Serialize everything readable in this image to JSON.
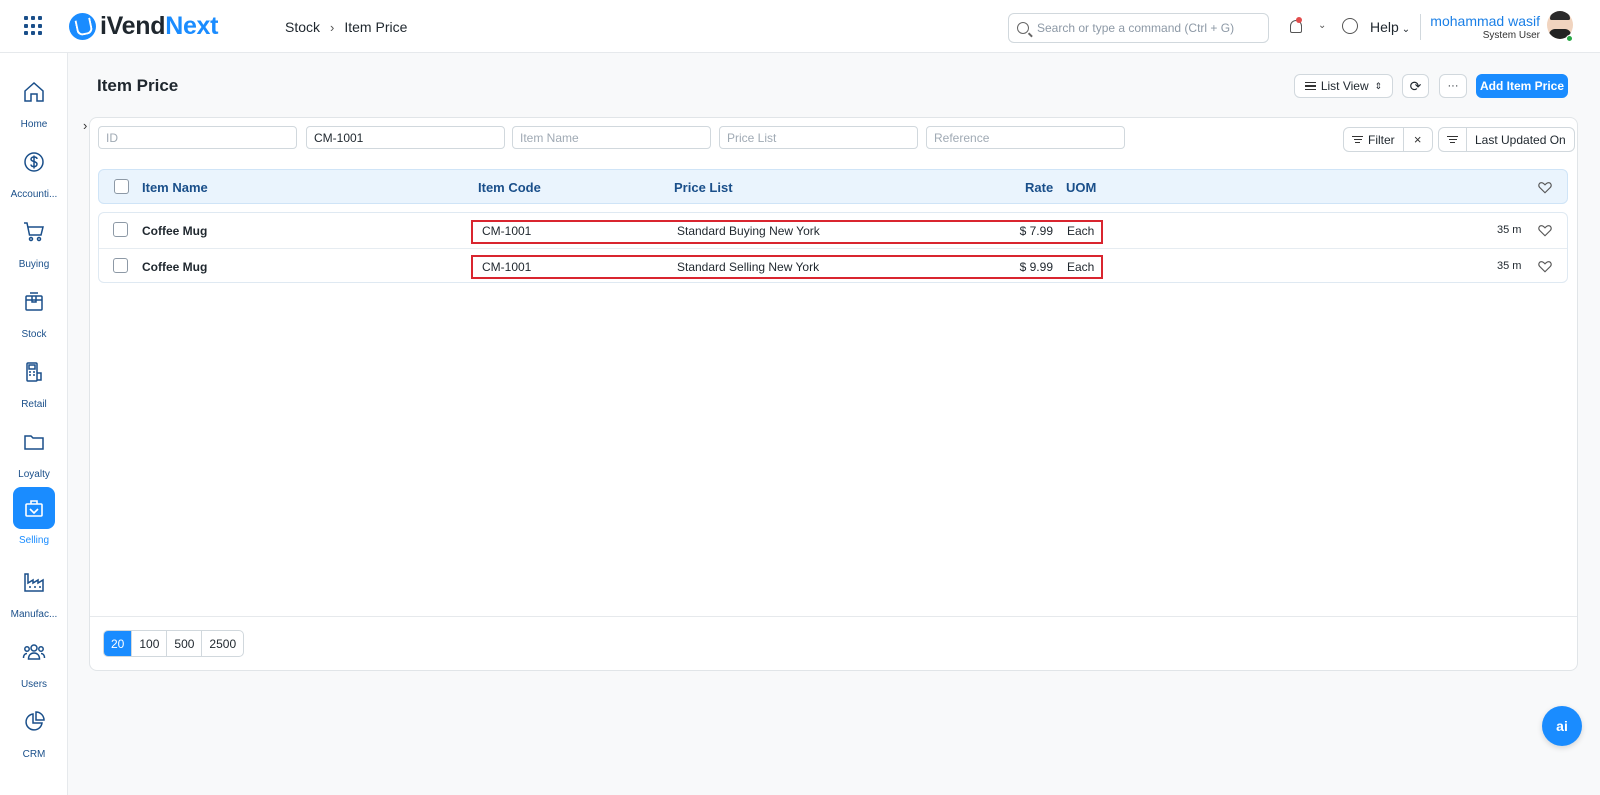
{
  "app": {
    "name_part1": "iVend",
    "name_part2": "Next"
  },
  "breadcrumb": {
    "parent": "Stock",
    "separator": "›",
    "current": "Item Price"
  },
  "search": {
    "placeholder": "Search or type a command (Ctrl + G)"
  },
  "header": {
    "help_label": "Help",
    "chevron": "⌄"
  },
  "user": {
    "name": "mohammad wasif",
    "role": "System User"
  },
  "sidebar": {
    "items": [
      {
        "label": "Home",
        "icon": "home-icon"
      },
      {
        "label": "Accounti...",
        "icon": "dollar-icon"
      },
      {
        "label": "Buying",
        "icon": "cart-icon"
      },
      {
        "label": "Stock",
        "icon": "box-icon"
      },
      {
        "label": "Retail",
        "icon": "pos-icon"
      },
      {
        "label": "Loyalty",
        "icon": "folder-icon"
      },
      {
        "label": "Selling",
        "icon": "bag-icon",
        "active": true
      },
      {
        "label": "Manufac...",
        "icon": "factory-icon"
      },
      {
        "label": "Users",
        "icon": "users-icon"
      },
      {
        "label": "CRM",
        "icon": "pie-icon"
      }
    ]
  },
  "page": {
    "title": "Item Price",
    "list_view_label": "List View",
    "more_label": "···",
    "add_button_label": "Add Item Price"
  },
  "filters": {
    "id_placeholder": "ID",
    "item_code_value": "CM-1001",
    "item_name_placeholder": "Item Name",
    "price_list_placeholder": "Price List",
    "reference_placeholder": "Reference",
    "filter_label": "Filter",
    "clear_label": "×",
    "sort_label": "Last Updated On"
  },
  "table": {
    "columns": {
      "item_name": "Item Name",
      "item_code": "Item Code",
      "price_list": "Price List",
      "rate": "Rate",
      "uom": "UOM"
    },
    "rows": [
      {
        "item_name": "Coffee Mug",
        "item_code": "CM-1001",
        "price_list": "Standard Buying New York",
        "rate": "$ 7.99",
        "uom": "Each",
        "modified": "35 m"
      },
      {
        "item_name": "Coffee Mug",
        "item_code": "CM-1001",
        "price_list": "Standard Selling New York",
        "rate": "$ 9.99",
        "uom": "Each",
        "modified": "35 m"
      }
    ]
  },
  "pagination": {
    "options": [
      "20",
      "100",
      "500",
      "2500"
    ],
    "selected": "20"
  },
  "assistant": {
    "label": "ai"
  },
  "colors": {
    "primary": "#1a8cff",
    "header_text": "#1a4f8a",
    "highlight": "#d9252f"
  }
}
